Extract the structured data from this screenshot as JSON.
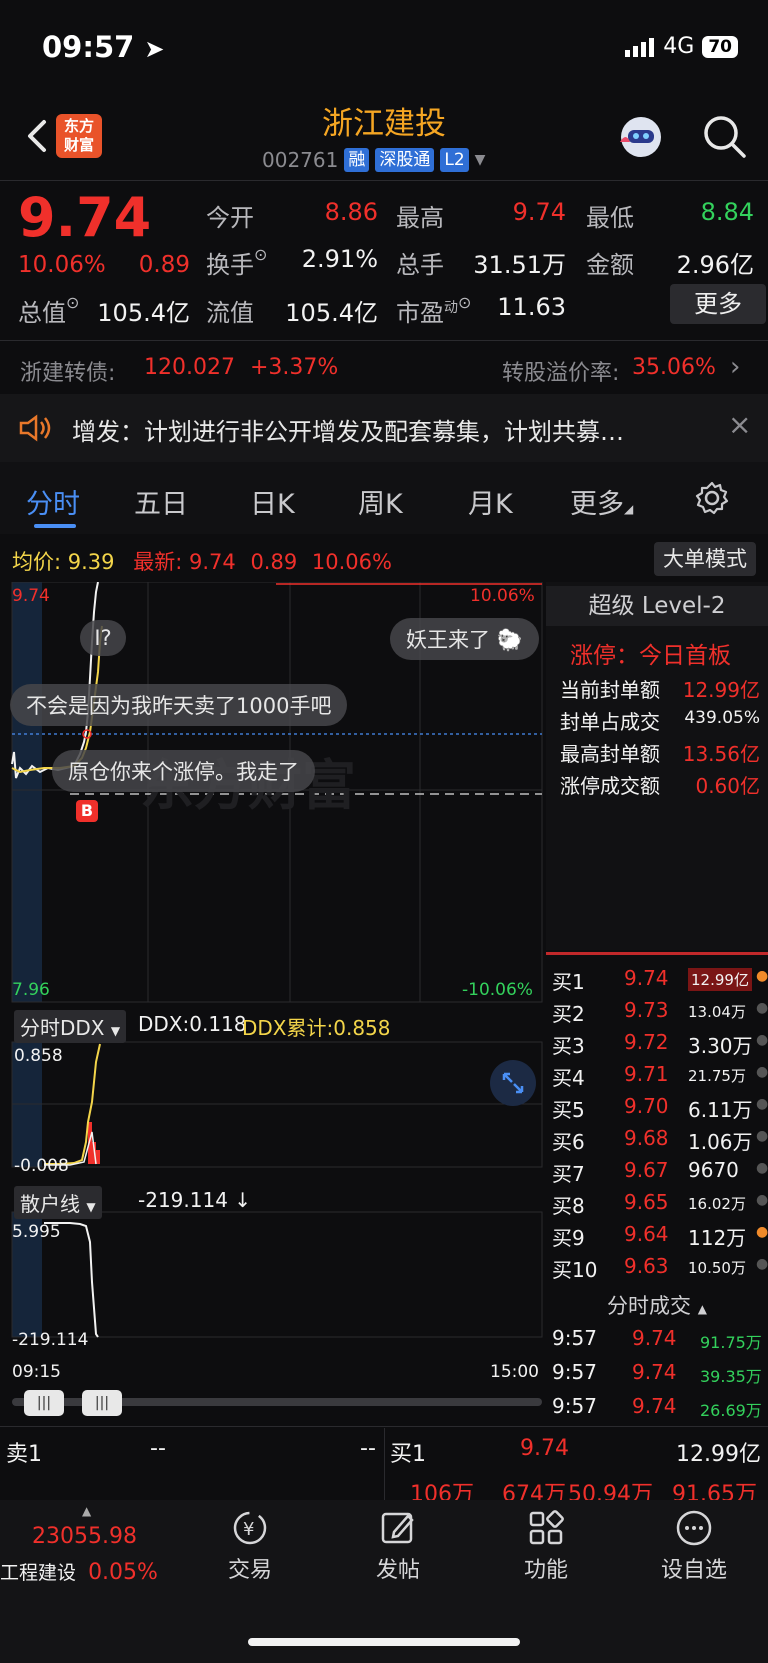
{
  "status_bar": {
    "time": "09:57",
    "network": "4G",
    "battery": "70"
  },
  "header": {
    "logo_text_1": "东方",
    "logo_text_2": "财富",
    "stock_name": "浙江建投",
    "stock_code": "002761",
    "tags": [
      "融",
      "深股通",
      "L2"
    ]
  },
  "quote": {
    "price": "9.74",
    "change_pct": "10.06%",
    "change": "0.89",
    "open_label": "今开",
    "open": "8.86",
    "high_label": "最高",
    "high": "9.74",
    "low_label": "最低",
    "low": "8.84",
    "turnover_label": "换手",
    "turnover": "2.91%",
    "volume_label": "总手",
    "volume": "31.51万",
    "amount_label": "金额",
    "amount": "2.96亿",
    "mktcap_label": "总值",
    "mktcap": "105.4亿",
    "float_label": "流值",
    "float_cap": "105.4亿",
    "pe_label": "市盈",
    "pe_sup": "动",
    "pe": "11.63",
    "more_button": "更多"
  },
  "bond": {
    "name": "浙建转债:",
    "price": "120.027",
    "change": "+3.37%",
    "premium_label": "转股溢价率:",
    "premium": "35.06%"
  },
  "notice": {
    "text": "增发：计划进行非公开增发及配套募集，计划共募…"
  },
  "tabs": [
    "分时",
    "五日",
    "日K",
    "周K",
    "月K",
    "更多"
  ],
  "chart_header": {
    "avg_label": "均价:",
    "avg": "9.39",
    "latest_label": "最新:",
    "latest": "9.74",
    "latest_change": "0.89",
    "latest_pct": "10.06%",
    "big_order_button": "大单模式"
  },
  "main_chart": {
    "y_top": "9.74",
    "y_bottom": "7.96",
    "pct_top": "10.06%",
    "pct_bottom": "-10.06%",
    "watermark": "东方财富",
    "buy_marker": "B",
    "bubbles": [
      "妖王来了",
      "不会是因为我昨天卖了1000手吧",
      "原仓你来个涨停。我走了",
      "I?"
    ]
  },
  "ddx": {
    "selector": "分时DDX",
    "ddx_label": "DDX:",
    "ddx": "0.118",
    "ddx_cum_label": "DDX累计:",
    "ddx_cum": "0.858",
    "y_top": "0.858",
    "y_bottom": "-0.008"
  },
  "retail": {
    "selector": "散户线",
    "value": "-219.114",
    "arrow": "↓",
    "y_top": "5.995",
    "y_bottom": "-219.114"
  },
  "time_axis": {
    "start": "09:15",
    "end": "15:00"
  },
  "level2": {
    "title": "超级 Level-2",
    "limit_label": "涨停：今日首板",
    "rows": [
      {
        "label": "当前封单额",
        "value": "12.99亿"
      },
      {
        "label": "封单占成交",
        "value": "439.05%"
      },
      {
        "label": "最高封单额",
        "value": "13.56亿"
      },
      {
        "label": "涨停成交额",
        "value": "0.60亿"
      }
    ]
  },
  "order_book": [
    {
      "label": "买1",
      "price": "9.74",
      "vol": "12.99亿"
    },
    {
      "label": "买2",
      "price": "9.73",
      "vol": "13.04万"
    },
    {
      "label": "买3",
      "price": "9.72",
      "vol": "3.30万"
    },
    {
      "label": "买4",
      "price": "9.71",
      "vol": "21.75万"
    },
    {
      "label": "买5",
      "price": "9.70",
      "vol": "6.11万"
    },
    {
      "label": "买6",
      "price": "9.68",
      "vol": "1.06万"
    },
    {
      "label": "买7",
      "price": "9.67",
      "vol": "9670"
    },
    {
      "label": "买8",
      "price": "9.65",
      "vol": "16.02万"
    },
    {
      "label": "买9",
      "price": "9.64",
      "vol": "112万"
    },
    {
      "label": "买10",
      "price": "9.63",
      "vol": "10.50万"
    }
  ],
  "ticks": {
    "title": "分时成交",
    "rows": [
      {
        "time": "9:57",
        "price": "9.74",
        "vol": "91.75万"
      },
      {
        "time": "9:57",
        "price": "9.74",
        "vol": "39.35万"
      },
      {
        "time": "9:57",
        "price": "9.74",
        "vol": "26.69万"
      }
    ]
  },
  "bottom_quote": {
    "sell1_label": "卖1",
    "sell1_price": "--",
    "sell1_vol": "--",
    "buy1_label": "买1",
    "buy1_price": "9.74",
    "buy1_vol": "12.99亿",
    "queue": [
      "106万",
      "674万",
      "50.94万",
      "91.65万"
    ]
  },
  "bottom_nav": {
    "index_value": "23055.98",
    "index_name": "工程建设",
    "index_change": "0.05%",
    "items": [
      "交易",
      "发帖",
      "功能",
      "设自选"
    ]
  },
  "colors": {
    "up": "#f0302b",
    "down": "#33d15c",
    "accent": "#4a8ff5",
    "brand": "#e9532a",
    "title": "#f5a623"
  }
}
